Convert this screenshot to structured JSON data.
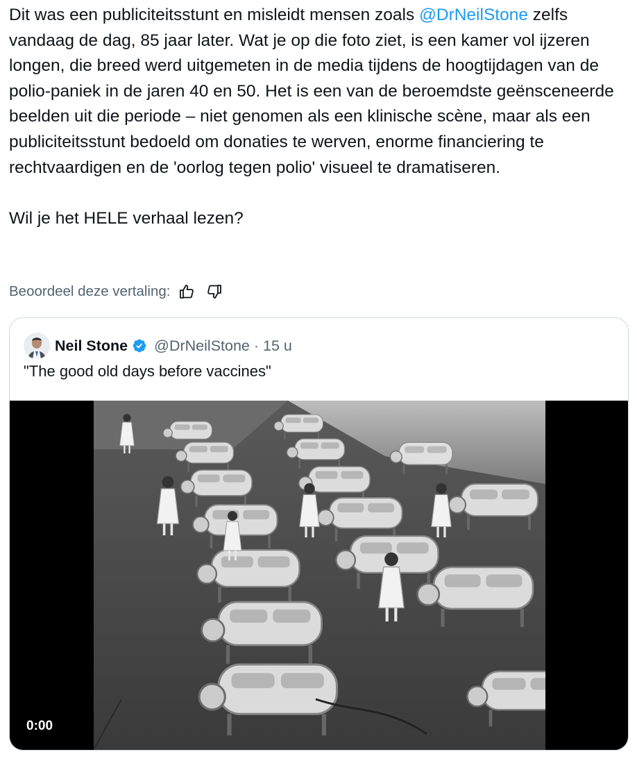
{
  "tweet": {
    "para1_before": "Dit was een publiciteitsstunt en misleidt mensen zoals ",
    "mention": "@DrNeilStone",
    "para1_after": " zelfs vandaag de dag, 85 jaar later. Wat je op die foto ziet, is een kamer vol ijzeren longen, die breed werd uitgemeten in de media tijdens de hoogtijdagen van de polio-paniek in de jaren 40 en 50. Het is een van de beroemdste geënsceneerde beelden uit die periode – niet genomen als een klinische scène, maar als een publiciteitsstunt bedoeld om donaties te werven, enorme financiering te rechtvaardigen en de 'oorlog tegen polio' visueel te dramatiseren.",
    "para2": "Wil je het HELE verhaal lezen?"
  },
  "translation_rating": {
    "label": "Beoordeel deze vertaling:",
    "thumbs_up_icon": "thumbs-up-icon",
    "thumbs_down_icon": "thumbs-down-icon"
  },
  "quoted": {
    "name": "Neil Stone",
    "handle_time": "@DrNeilStone · 15 u",
    "text": "\"The good old days before vaccines\"",
    "video_time": "0:00",
    "verified_color": "#1d9bf0"
  },
  "colors": {
    "accent": "#1d9bf0",
    "secondary_text": "#536471",
    "border": "#cfd9de"
  }
}
